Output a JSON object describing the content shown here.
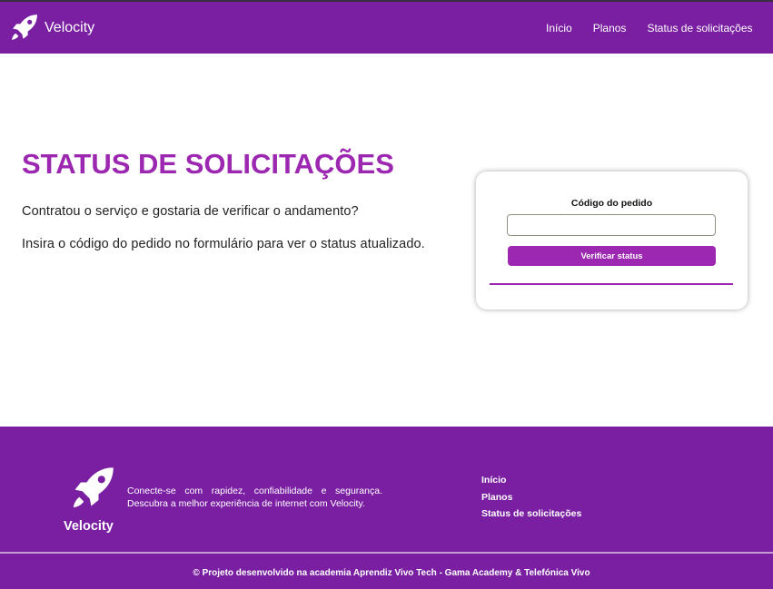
{
  "header": {
    "brand_name": "Velocity",
    "nav": [
      {
        "label": "Início"
      },
      {
        "label": "Planos"
      },
      {
        "label": "Status de solicitações"
      }
    ]
  },
  "hero": {
    "title": "STATUS DE SOLICITAÇÕES",
    "line1": "Contratou o serviço e gostaria de verificar o andamento?",
    "line2": "Insira o código do pedido no formulário para ver o status atualizado."
  },
  "form": {
    "label": "Código do pedido",
    "input_value": "",
    "button_label": "Verificar status"
  },
  "footer": {
    "brand_name": "Velocity",
    "tagline": "Conecte-se com rapidez, confiabilidade e segurança. Descubra a melhor experiência de internet com Velocity.",
    "links": [
      {
        "label": "Início"
      },
      {
        "label": "Planos"
      },
      {
        "label": "Status de solicitações"
      }
    ],
    "copyright": "© Projeto desenvolvido na academia Aprendiz Vivo Tech - Gama Academy & Telefónica Vivo"
  },
  "icons": {
    "brand_logo": "rocket-icon"
  },
  "colors": {
    "primary_purple": "#7a1fa2",
    "accent_purple": "#9c27b0",
    "white": "#ffffff"
  }
}
